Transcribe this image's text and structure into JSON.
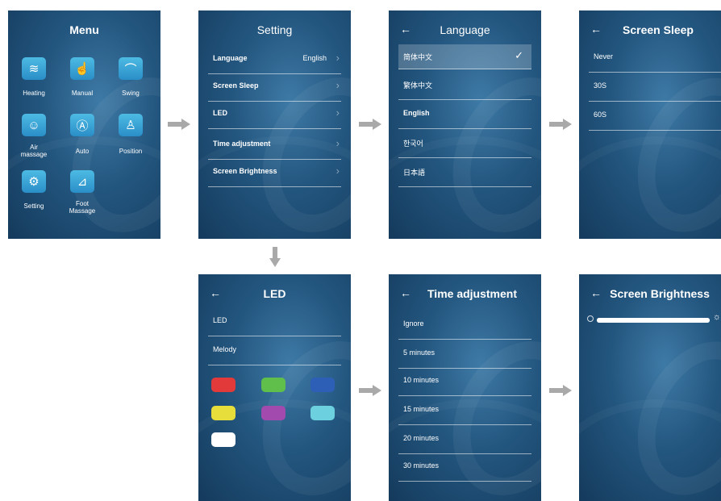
{
  "menu": {
    "title": "Menu",
    "items": [
      {
        "label": "Heating",
        "icon": "heating-icon",
        "glyph": "≋"
      },
      {
        "label": "Manual",
        "icon": "hand-icon",
        "glyph": "☝"
      },
      {
        "label": "Swing",
        "icon": "swing-icon",
        "glyph": "⌒"
      },
      {
        "label": "Air\nmassage",
        "icon": "air-massage-icon",
        "glyph": "☺"
      },
      {
        "label": "Auto",
        "icon": "auto-icon",
        "glyph": "Ⓐ"
      },
      {
        "label": "Position",
        "icon": "chair-icon",
        "glyph": "♙"
      },
      {
        "label": "Setting",
        "icon": "gear-icon",
        "glyph": "⚙"
      },
      {
        "label": "Foot\nMassage",
        "icon": "foot-icon",
        "glyph": "⊿"
      }
    ]
  },
  "setting": {
    "title": "Setting",
    "rows": [
      {
        "label": "Language",
        "value": "English"
      },
      {
        "label": "Screen Sleep",
        "value": ""
      },
      {
        "label": "LED",
        "value": ""
      },
      {
        "label": "Time adjustment",
        "value": ""
      },
      {
        "label": "Screen Brightness",
        "value": ""
      }
    ],
    "chevron": "›"
  },
  "language": {
    "title": "Language",
    "back": "←",
    "check": "✓",
    "options": [
      "简体中文",
      "繁体中文",
      "English",
      "한국어",
      "日本語"
    ],
    "selected_index": 0
  },
  "screen_sleep": {
    "title": "Screen Sleep",
    "back": "←",
    "options": [
      "Never",
      "30S",
      "60S"
    ]
  },
  "led": {
    "title": "LED",
    "back": "←",
    "rows": [
      "LED",
      "Melody"
    ],
    "colors": [
      "#e23a3a",
      "#5fbf4a",
      "#2c5fb5",
      "#e8de3b",
      "#a24aad",
      "#6cd0de",
      "#ffffff"
    ]
  },
  "time_adjustment": {
    "title": "Time adjustment",
    "back": "←",
    "options": [
      "Ignore",
      "5 minutes",
      "10 minutes",
      "15 minutes",
      "20 minutes",
      "30 minutes"
    ]
  },
  "screen_brightness": {
    "title": "Screen Brightness",
    "back": "←",
    "level": 1.0
  }
}
